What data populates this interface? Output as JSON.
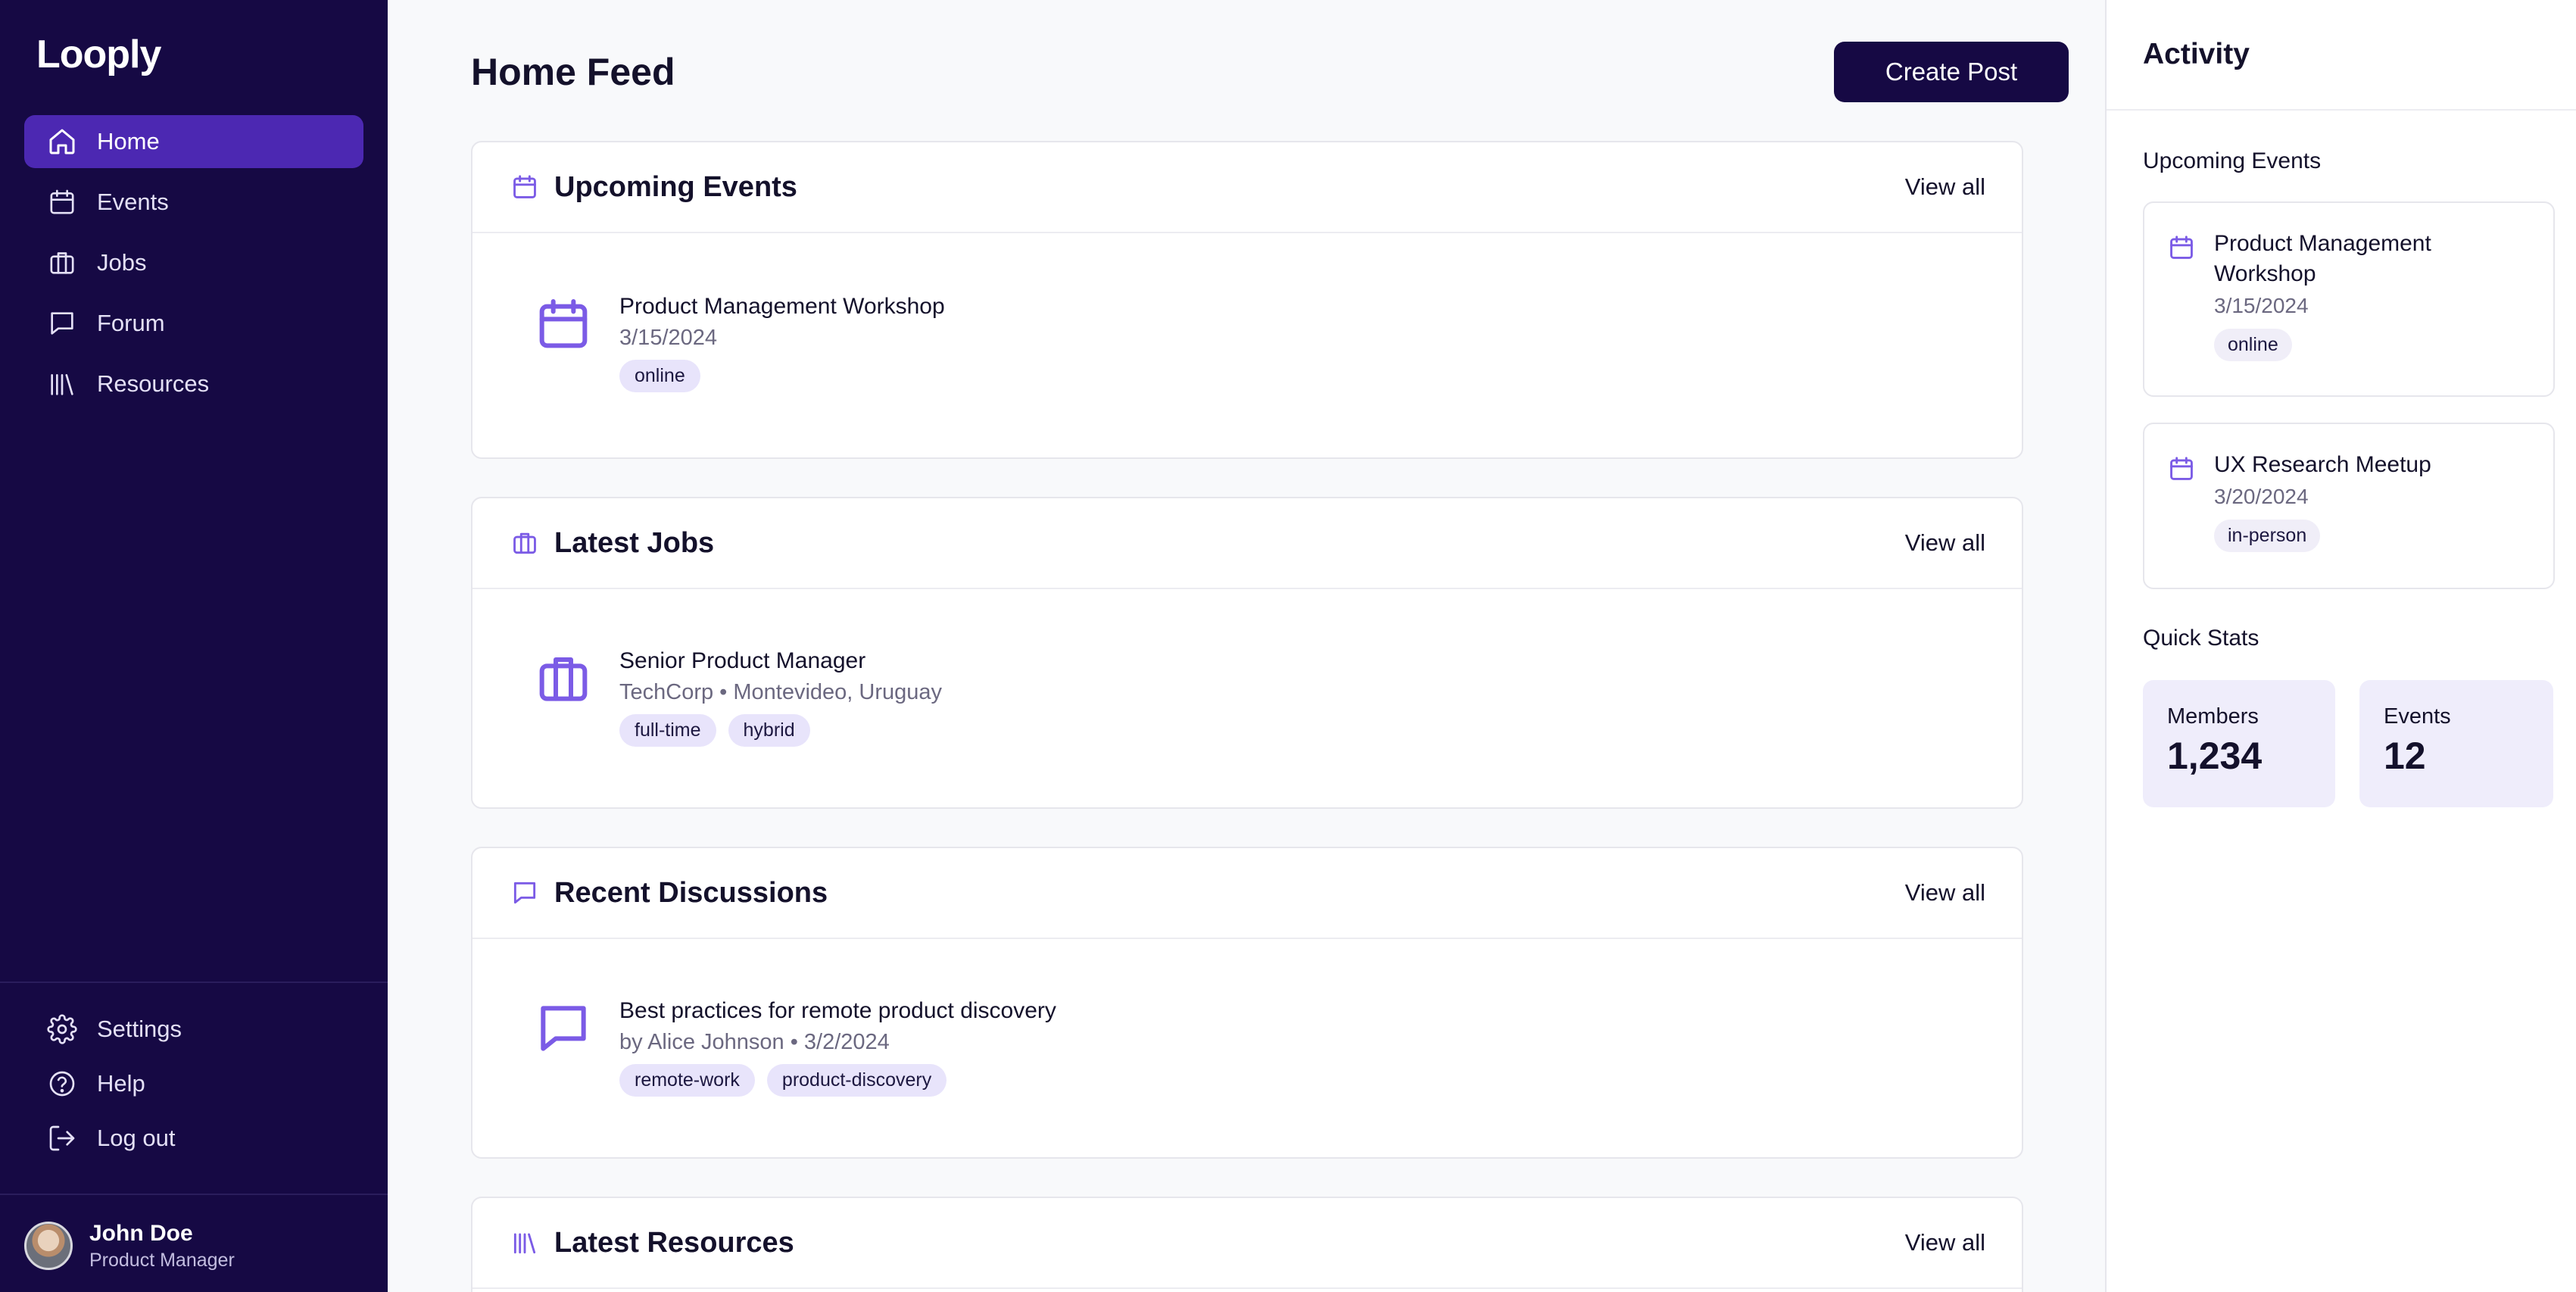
{
  "app": {
    "name": "Looply"
  },
  "sidebar": {
    "items": [
      {
        "label": "Home",
        "icon": "home-icon",
        "active": true
      },
      {
        "label": "Events",
        "icon": "calendar-icon"
      },
      {
        "label": "Jobs",
        "icon": "briefcase-icon"
      },
      {
        "label": "Forum",
        "icon": "chat-icon"
      },
      {
        "label": "Resources",
        "icon": "library-icon"
      }
    ],
    "bottom_items": [
      {
        "label": "Settings",
        "icon": "gear-icon"
      },
      {
        "label": "Help",
        "icon": "help-icon"
      },
      {
        "label": "Log out",
        "icon": "logout-icon"
      }
    ],
    "user": {
      "name": "John Doe",
      "role": "Product Manager"
    }
  },
  "main": {
    "title": "Home Feed",
    "create_button": "Create Post",
    "sections": [
      {
        "title": "Upcoming Events",
        "view_all": "View all",
        "icon": "calendar-icon",
        "item": {
          "title": "Product Management Workshop",
          "subtitle": "3/15/2024",
          "tags": [
            "online"
          ]
        }
      },
      {
        "title": "Latest Jobs",
        "view_all": "View all",
        "icon": "briefcase-icon",
        "item": {
          "title": "Senior Product Manager",
          "subtitle": "TechCorp • Montevideo, Uruguay",
          "tags": [
            "full-time",
            "hybrid"
          ]
        }
      },
      {
        "title": "Recent Discussions",
        "view_all": "View all",
        "icon": "chat-icon",
        "item": {
          "title": "Best practices for remote product discovery",
          "subtitle": "by Alice Johnson • 3/2/2024",
          "tags": [
            "remote-work",
            "product-discovery"
          ]
        }
      },
      {
        "title": "Latest Resources",
        "view_all": "View all",
        "icon": "library-icon"
      }
    ]
  },
  "activity": {
    "title": "Activity",
    "upcoming_label": "Upcoming Events",
    "events": [
      {
        "title": "Product Management Workshop",
        "date": "3/15/2024",
        "tag": "online"
      },
      {
        "title": "UX Research Meetup",
        "date": "3/20/2024",
        "tag": "in-person"
      }
    ],
    "stats_label": "Quick Stats",
    "stats": [
      {
        "label": "Members",
        "value": "1,234"
      },
      {
        "label": "Events",
        "value": "12"
      }
    ]
  },
  "colors": {
    "sidebar_bg": "#160944",
    "active_nav": "#4c28b2",
    "accent_icon": "#7b5be6",
    "tag_bg": "#e8e4fb",
    "stat_bg": "#efedfb"
  }
}
